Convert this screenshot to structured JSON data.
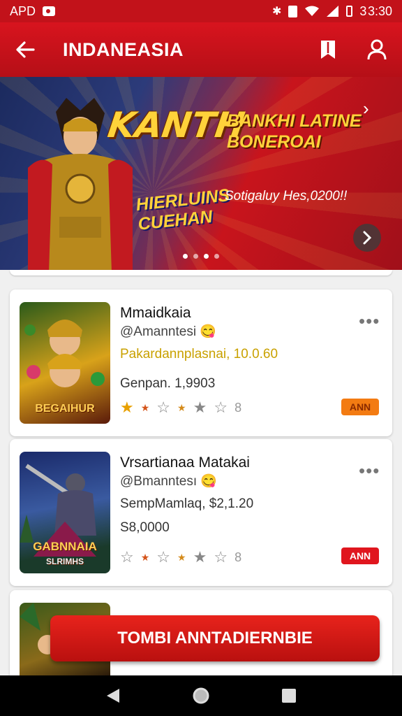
{
  "status_bar": {
    "left_text": "APD",
    "time": "3:30",
    "right_prefix": "3"
  },
  "app_bar": {
    "title": "INDANEASIA"
  },
  "banner": {
    "headline": "KANTH",
    "headline_right_1": "BANKHI LATINE",
    "headline_right_2": "BONEROAI",
    "sub_logo_1": "HIERLUINS",
    "sub_logo_2": "CUEHAN",
    "promo_text": "Sotigaluy Hes,0200!!"
  },
  "cards": [
    {
      "name": "Mmaidkaia",
      "handle": "@Amanntesi 😋",
      "line1": "Pakardannplasnai, 10.0.60",
      "line1_color": "#c9a100",
      "line2": "Genpan. 1,9903",
      "stars_count_text": "8",
      "badge": "ANN",
      "badge_style": "orange",
      "thumb_text": "BEGAIHUR"
    },
    {
      "name": "Vrsartianaa Matakai",
      "handle": "@Bmanntesı 😋",
      "line1": "SempMamlaq, $2,1.20",
      "line1_color": "#333333",
      "line2": "S8,0000",
      "stars_count_text": "8",
      "badge": "ANN",
      "badge_style": "red",
      "thumb_text_1": "GABNNAIA",
      "thumb_text_2": "SLRIMHS"
    }
  ],
  "cta": {
    "label": "TOMBI ANNTADIERNBIE"
  },
  "colors": {
    "brand_red": "#c2121a",
    "badge_orange": "#f37b12",
    "badge_red": "#e0161e"
  }
}
